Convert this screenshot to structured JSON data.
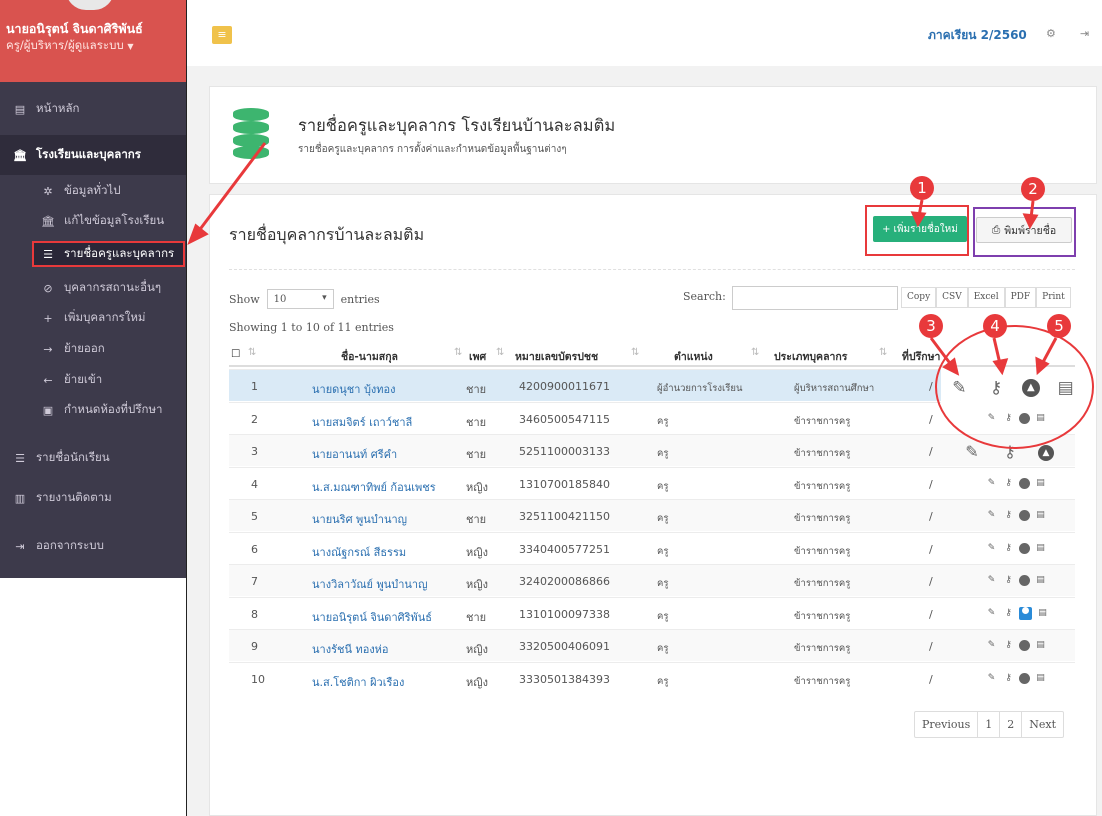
{
  "sidebar": {
    "user_name": "นายอนิรุตน์ จินดาศิริพันธ์",
    "user_role": "ครู/ผู้บริหาร/ผู้ดูแลระบบ",
    "items": [
      {
        "label": "หน้าหลัก",
        "icon": "dashboard-icon"
      },
      {
        "label": "โรงเรียนและบุคลากร",
        "icon": "bank-icon"
      },
      {
        "label": "ข้อมูลทั่วไป",
        "icon": "cog-icon"
      },
      {
        "label": "แก้ไขข้อมูลโรงเรียน",
        "icon": "bank-icon"
      },
      {
        "label": "รายชื่อครูและบุคลากร",
        "icon": "database-icon"
      },
      {
        "label": "บุคลากรสถานะอื่นๆ",
        "icon": "ban-icon"
      },
      {
        "label": "เพิ่มบุคลากรใหม่",
        "icon": "plus-icon"
      },
      {
        "label": "ย้ายออก",
        "icon": "arrow-right-icon"
      },
      {
        "label": "ย้ายเข้า",
        "icon": "arrow-left-icon"
      },
      {
        "label": "กำหนดห้องที่ปรึกษา",
        "icon": "monitor-icon"
      },
      {
        "label": "รายชื่อนักเรียน",
        "icon": "list-icon"
      },
      {
        "label": "รายงานติดตาม",
        "icon": "bar-chart-icon"
      },
      {
        "label": "ออกจากระบบ",
        "icon": "sign-out-icon"
      }
    ]
  },
  "topbar": {
    "semester": "ภาคเรียน 2/2560"
  },
  "header_panel": {
    "title": "รายชื่อครูและบุคลากร โรงเรียนบ้านละลมติม",
    "subtitle": "รายชื่อครูและบุคลากร การตั้งค่าและกำหนดข้อมูลพื้นฐานต่างๆ"
  },
  "main_panel": {
    "title": "รายชื่อบุคลากรบ้านละลมติม",
    "add_button": "เพิ่มรายชื่อใหม่",
    "print_button": "พิมพ์รายชื่อ",
    "show_label": "Show",
    "entries_label": "entries",
    "page_length": "10",
    "search_label": "Search:",
    "export_buttons": [
      "Copy",
      "CSV",
      "Excel",
      "PDF",
      "Print"
    ],
    "showing_text": "Showing 1 to 10 of 11 entries",
    "columns": [
      "ชื่อ-นามสกุล",
      "เพศ",
      "หมายเลขบัตรปชช",
      "ตำแหน่ง",
      "ประเภทบุคลากร",
      "ที่ปรึกษา"
    ],
    "rows": [
      {
        "no": "1",
        "name": "นายดนุชา บุ้งทอง",
        "sex": "ชาย",
        "id": "4200900011671",
        "position": "ผู้อำนวยการโรงเรียน",
        "type": "ผู้บริหารสถานศึกษา",
        "advisor": "/"
      },
      {
        "no": "2",
        "name": "นายสมจิตร์ เถาว์ชาลี",
        "sex": "ชาย",
        "id": "3460500547115",
        "position": "ครู",
        "type": "ข้าราชการครู",
        "advisor": "/"
      },
      {
        "no": "3",
        "name": "นายอานนท์ ศรีคำ",
        "sex": "ชาย",
        "id": "5251100003133",
        "position": "ครู",
        "type": "ข้าราชการครู",
        "advisor": "/"
      },
      {
        "no": "4",
        "name": "น.ส.มณฑาทิพย์ ก้อนเพชร",
        "sex": "หญิง",
        "id": "1310700185840",
        "position": "ครู",
        "type": "ข้าราชการครู",
        "advisor": "/"
      },
      {
        "no": "5",
        "name": "นายนริศ พูนบำนาญ",
        "sex": "ชาย",
        "id": "3251100421150",
        "position": "ครู",
        "type": "ข้าราชการครู",
        "advisor": "/"
      },
      {
        "no": "6",
        "name": "นางณัฐกรณ์ สีธรรม",
        "sex": "หญิง",
        "id": "3340400577251",
        "position": "ครู",
        "type": "ข้าราชการครู",
        "advisor": "/"
      },
      {
        "no": "7",
        "name": "นางวิลาวัณย์ พูนบำนาญ",
        "sex": "หญิง",
        "id": "3240200086866",
        "position": "ครู",
        "type": "ข้าราชการครู",
        "advisor": "/"
      },
      {
        "no": "8",
        "name": "นายอนิรุตน์ จินดาศิริพันธ์",
        "sex": "ชาย",
        "id": "1310100097338",
        "position": "ครู",
        "type": "ข้าราชการครู",
        "advisor": "/"
      },
      {
        "no": "9",
        "name": "นางรัชนี ทองห่อ",
        "sex": "หญิง",
        "id": "3320500406091",
        "position": "ครู",
        "type": "ข้าราชการครู",
        "advisor": "/"
      },
      {
        "no": "10",
        "name": "น.ส.โชติกา ผิวเรือง",
        "sex": "หญิง",
        "id": "3330501384393",
        "position": "ครู",
        "type": "ข้าราชการครู",
        "advisor": "/"
      }
    ],
    "pagination": [
      "Previous",
      "1",
      "2",
      "Next"
    ]
  },
  "annotations": [
    "1",
    "2",
    "3",
    "4",
    "5"
  ],
  "colors": {
    "accent_red": "#e8393b",
    "sidebar_bg": "#3d3a4b",
    "add_green": "#27b07b",
    "link_blue": "#2a6fb0"
  }
}
